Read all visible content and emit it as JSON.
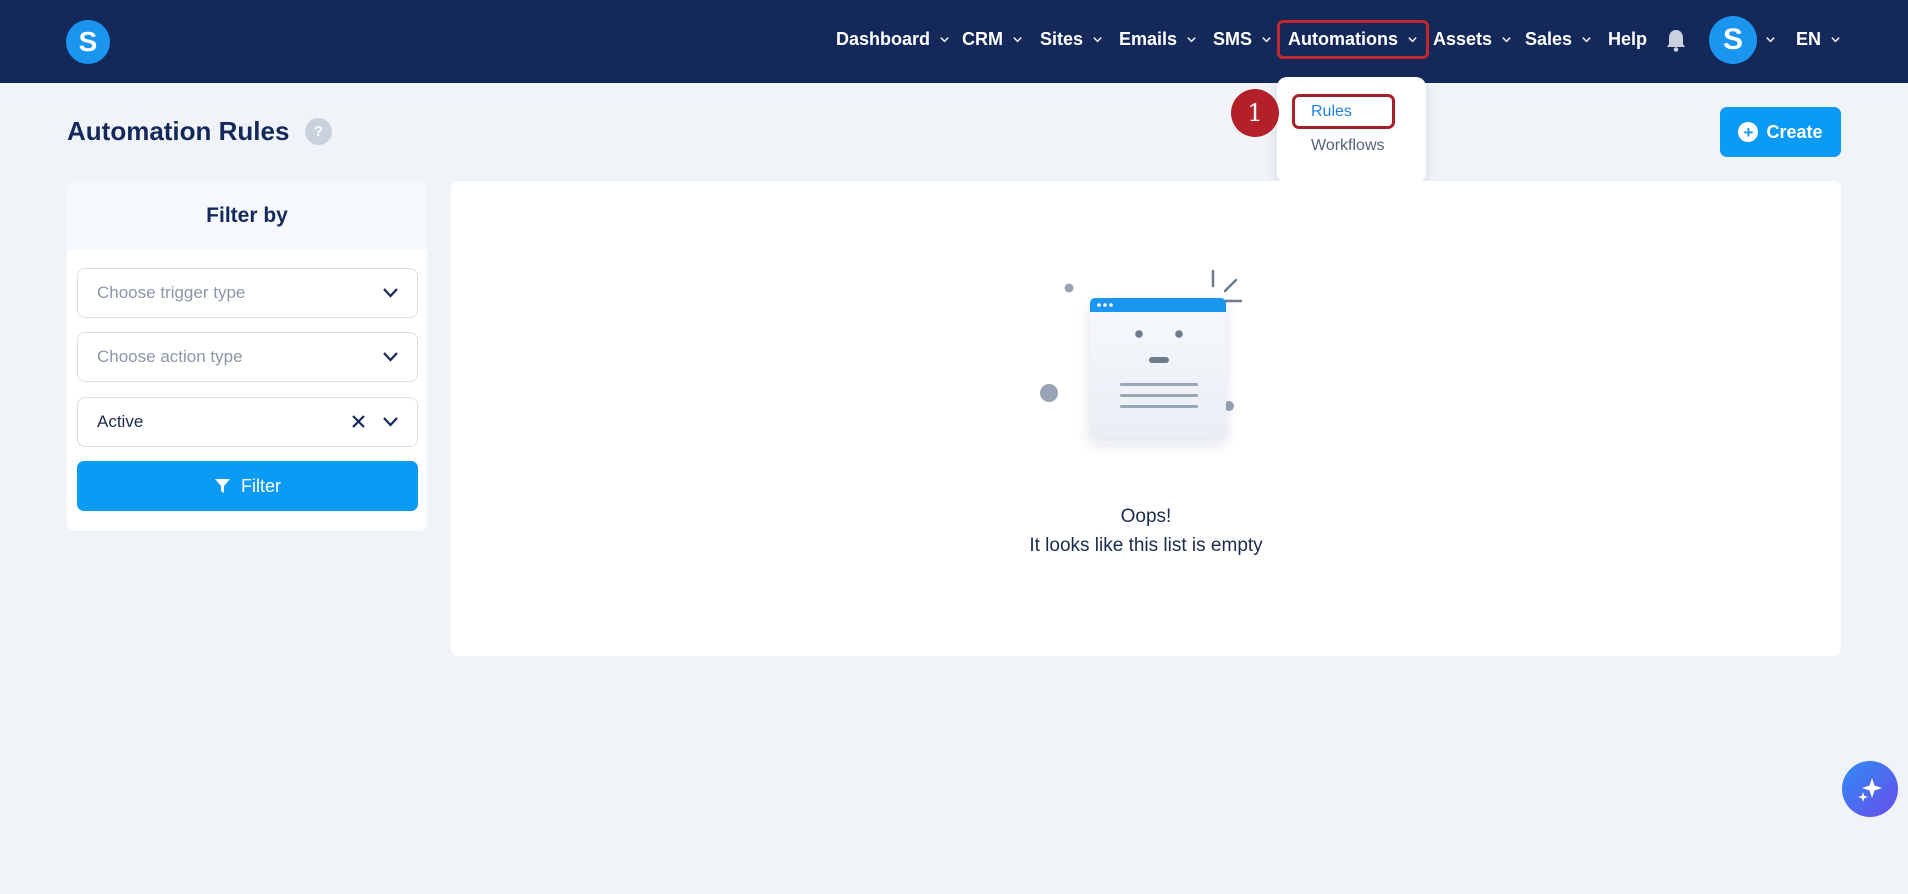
{
  "app": {
    "logo_letter": "S"
  },
  "nav": {
    "items": [
      {
        "label": "Dashboard"
      },
      {
        "label": "CRM"
      },
      {
        "label": "Sites"
      },
      {
        "label": "Emails"
      },
      {
        "label": "SMS"
      },
      {
        "label": "Automations"
      },
      {
        "label": "Assets"
      },
      {
        "label": "Sales"
      },
      {
        "label": "Help"
      }
    ],
    "avatar_letter": "S",
    "language": "EN"
  },
  "automations_menu": {
    "items": [
      {
        "label": "Rules"
      },
      {
        "label": "Workflows"
      }
    ],
    "step_marker": "1"
  },
  "page": {
    "title": "Automation Rules",
    "help_glyph": "?",
    "create_label": "Create"
  },
  "filter": {
    "header": "Filter by",
    "trigger_placeholder": "Choose trigger type",
    "action_placeholder": "Choose action type",
    "status_value": "Active",
    "button_label": "Filter"
  },
  "empty_state": {
    "line1": "Oops!",
    "line2": "It looks like this list is empty"
  },
  "colors": {
    "nav_bg": "#14295a",
    "primary": "#0b9bf4",
    "highlight": "#c0282d",
    "page_bg": "#f0f4f9"
  }
}
